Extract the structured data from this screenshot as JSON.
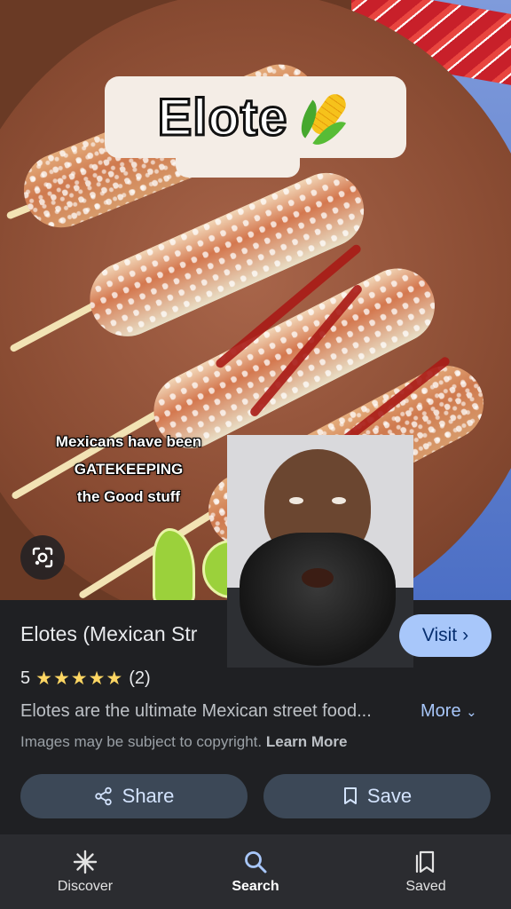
{
  "overlay": {
    "title": "Elote",
    "title_emoji": "corn-emoji",
    "caption": "Mexicans have been\nGATEKEEPING\nthe Good stuff"
  },
  "result": {
    "title": "Elotes (Mexican Str",
    "visit_label": "Visit",
    "rating_value": "5",
    "rating_stars": "★★★★★",
    "rating_count": "(2)",
    "description": "Elotes are the ultimate Mexican street food...",
    "more_label": "More",
    "copyright_text": "Images may be subject to copyright.",
    "learn_more_label": "Learn More"
  },
  "actions": {
    "share_label": "Share",
    "save_label": "Save"
  },
  "nav": {
    "items": [
      {
        "label": "Discover",
        "icon": "asterisk-icon"
      },
      {
        "label": "Search",
        "icon": "search-icon"
      },
      {
        "label": "Saved",
        "icon": "bookmarks-icon"
      }
    ],
    "active": "Search"
  },
  "colors": {
    "accent": "#a8c7fa",
    "star": "#fdd663",
    "background": "#1f2023"
  }
}
